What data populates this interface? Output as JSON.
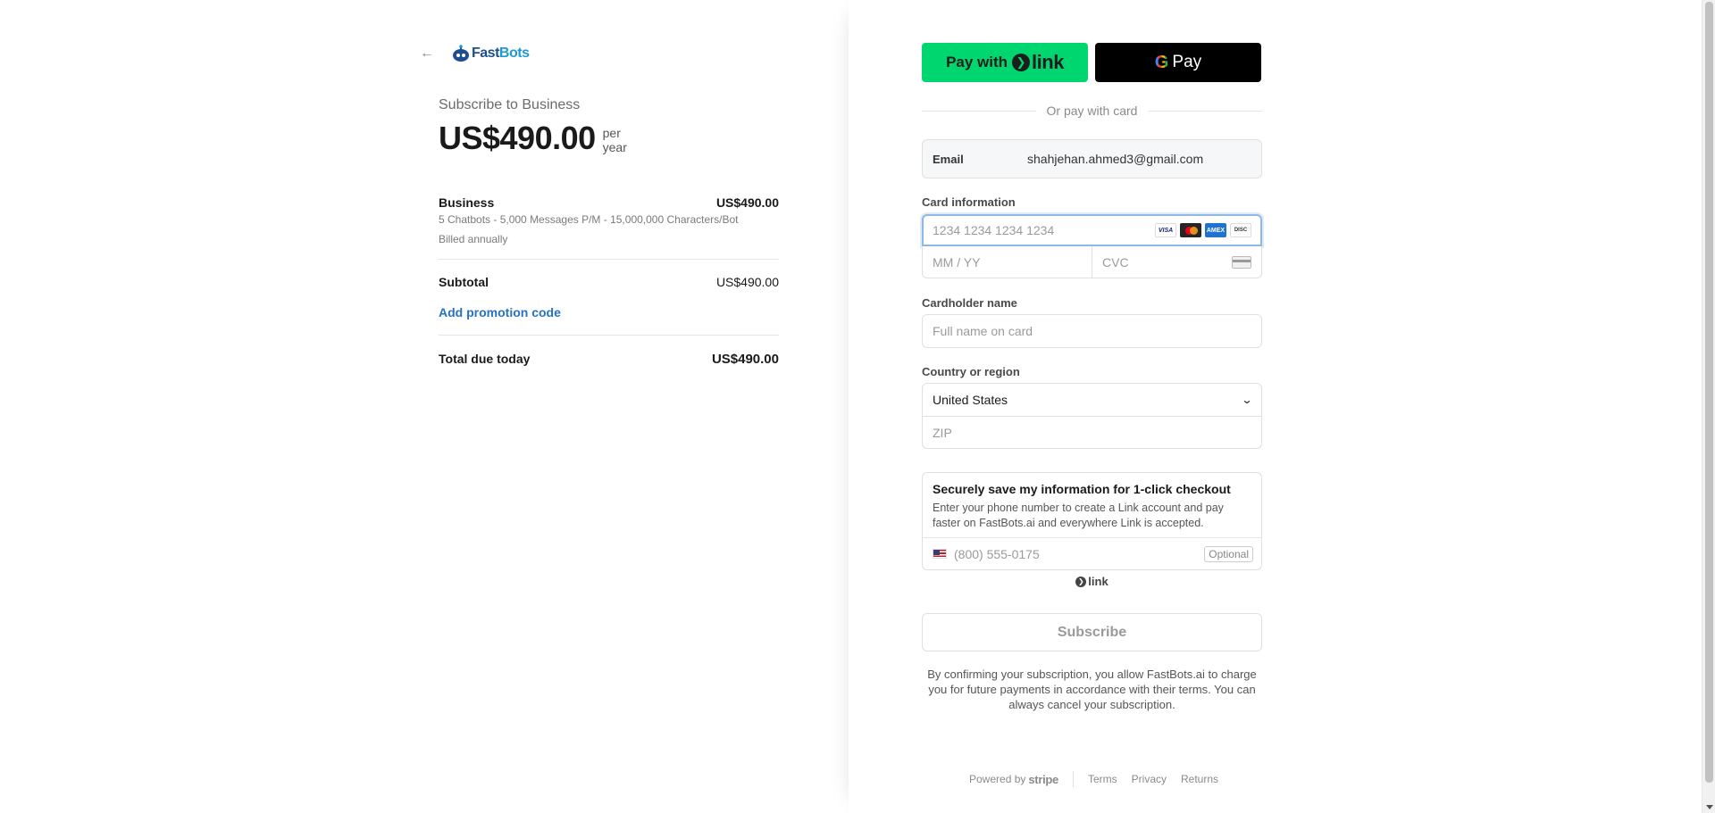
{
  "summary": {
    "logo_text_main": "Fast",
    "logo_text_accent": "Bots",
    "subscribe_title": "Subscribe to Business",
    "price": "US$490.00",
    "period_line1": "per",
    "period_line2": "year",
    "line_item": {
      "name": "Business",
      "amount": "US$490.00",
      "description": "5 Chatbots - 5,000 Messages P/M - 15,000,000 Characters/Bot",
      "billing": "Billed annually"
    },
    "subtotal_label": "Subtotal",
    "subtotal_amount": "US$490.00",
    "promo_label": "Add promotion code",
    "total_label": "Total due today",
    "total_amount": "US$490.00"
  },
  "payment": {
    "link_button_prefix": "Pay with",
    "link_button_word": "link",
    "gpay_label": "Pay",
    "or_divider": "Or pay with card",
    "email_label": "Email",
    "email_value": "shahjehan.ahmed3@gmail.com",
    "card_info_label": "Card information",
    "card_number_placeholder": "1234 1234 1234 1234",
    "brands": [
      "VISA",
      "MC",
      "AMEX",
      "DISCOVER"
    ],
    "expiry_placeholder": "MM / YY",
    "cvc_placeholder": "CVC",
    "cardholder_label": "Cardholder name",
    "cardholder_placeholder": "Full name on card",
    "country_label": "Country or region",
    "country_value": "United States",
    "zip_placeholder": "ZIP",
    "save_title": "Securely save my information for 1-click checkout",
    "save_description": "Enter your phone number to create a Link account and pay faster on FastBots.ai and everywhere Link is accepted.",
    "phone_placeholder": "(800) 555-0175",
    "optional_label": "Optional",
    "link_badge": "link",
    "subscribe_label": "Subscribe",
    "consent": "By confirming your subscription, you allow FastBots.ai to charge you for future payments in accordance with their terms. You can always cancel your subscription."
  },
  "footer": {
    "powered_by": "Powered by",
    "stripe": "stripe",
    "terms": "Terms",
    "privacy": "Privacy",
    "returns": "Returns"
  },
  "colors": {
    "link_green": "#00d66f",
    "accent_blue": "#2573c2",
    "focus_border": "#8eb8e6"
  }
}
